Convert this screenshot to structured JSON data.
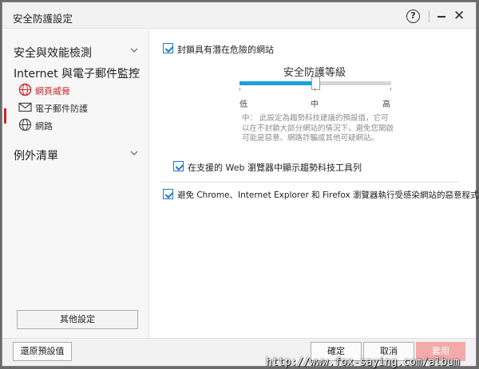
{
  "window": {
    "title": "安全防護設定",
    "help_glyph": "?",
    "close_glyph": "✕"
  },
  "sidebar": {
    "section1": {
      "label": "安全與效能檢測",
      "chevron": "⌵"
    },
    "section2": {
      "label": "Internet 與電子郵件監控",
      "chevron": "︿",
      "items": [
        {
          "label": "網頁威脅",
          "icon": "web-threat-icon",
          "active": true
        },
        {
          "label": "電子郵件防護",
          "icon": "mail-icon",
          "active": false
        },
        {
          "label": "網路",
          "icon": "network-icon",
          "active": false
        }
      ]
    },
    "section3": {
      "label": "例外清單",
      "chevron": "⌵"
    },
    "other_settings": "其他設定"
  },
  "main": {
    "block_sites": {
      "label": "封鎖具有潛在危險的網站",
      "checked": true
    },
    "security_level": {
      "title": "安全防護等級",
      "levels": [
        "低",
        "中",
        "高"
      ],
      "value": "中",
      "value_fraction": 0.5,
      "description": "中： 此設定為趨勢科技建議的預設值，它可以在不封鎖大部分網站的情況下，避免您開啟可能是惡意、網路詐騙或其他可疑網站。"
    },
    "toolbar_option": {
      "label": "在支援的 Web 瀏覽器中顯示趨勢科技工具列",
      "checked": true
    },
    "prevent_scripts": {
      "label": "避免 Chrome、Internet Explorer 和 Firefox 瀏覽器執行受感染網站的惡意程式檔",
      "checked": true
    }
  },
  "footer": {
    "restore": "還原預設值",
    "ok": "確定",
    "cancel": "取消",
    "apply": "套用"
  },
  "watermark": "http://www.fox-saying.com/album",
  "colors": {
    "accent_blue": "#1aa0dc",
    "active_red": "#c8262c",
    "apply_disabled": "#f3aaab"
  }
}
